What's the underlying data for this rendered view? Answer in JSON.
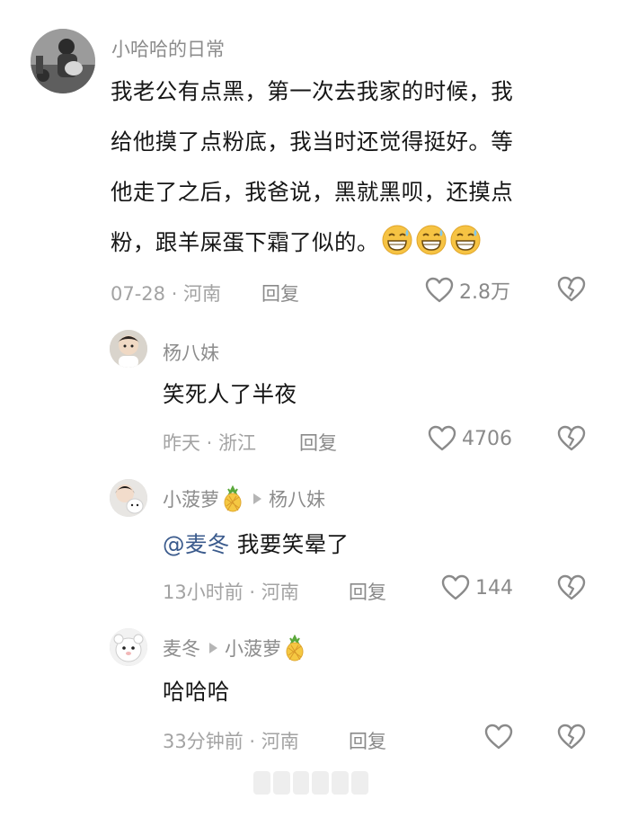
{
  "comments": [
    {
      "username": "小哈哈的日常",
      "text_lines": [
        "我老公有点黑，第一次去我家的时候，我",
        "给他摸了点粉底，我当时还觉得挺好。等",
        "他走了之后，我爸说，黑就黑呗，还摸点",
        "粉，跟羊屎蛋下霜了似的。"
      ],
      "emoji": [
        "grinning-sweat-emoji",
        "grinning-sweat-emoji",
        "grinning-sweat-emoji"
      ],
      "meta": "07-28 · 河南",
      "reply_label": "回复",
      "likes": "2.8万"
    },
    {
      "username": "杨八妹",
      "text": "笑死人了半夜",
      "meta": "昨天 · 浙江",
      "reply_label": "回复",
      "likes": "4706"
    },
    {
      "username": "小菠萝",
      "reply_to": "杨八妹",
      "mention": "@麦冬",
      "text": "我要笑晕了",
      "meta": "13小时前 · 河南",
      "reply_label": "回复",
      "likes": "144"
    },
    {
      "username": "麦冬",
      "reply_to": "小菠萝",
      "text": "哈哈哈",
      "meta": "33分钟前 · 河南",
      "reply_label": "回复",
      "likes": ""
    }
  ],
  "icons": {
    "like": "heart-outline-icon",
    "dislike": "broken-heart-icon",
    "reply_indicator": "triangle-right-icon",
    "pineapple": "pineapple-emoji"
  },
  "colors": {
    "username": "#8c8c8c",
    "meta": "#a3a3a3",
    "mention": "#3a5a8c",
    "icon": "#8a8a8a"
  }
}
